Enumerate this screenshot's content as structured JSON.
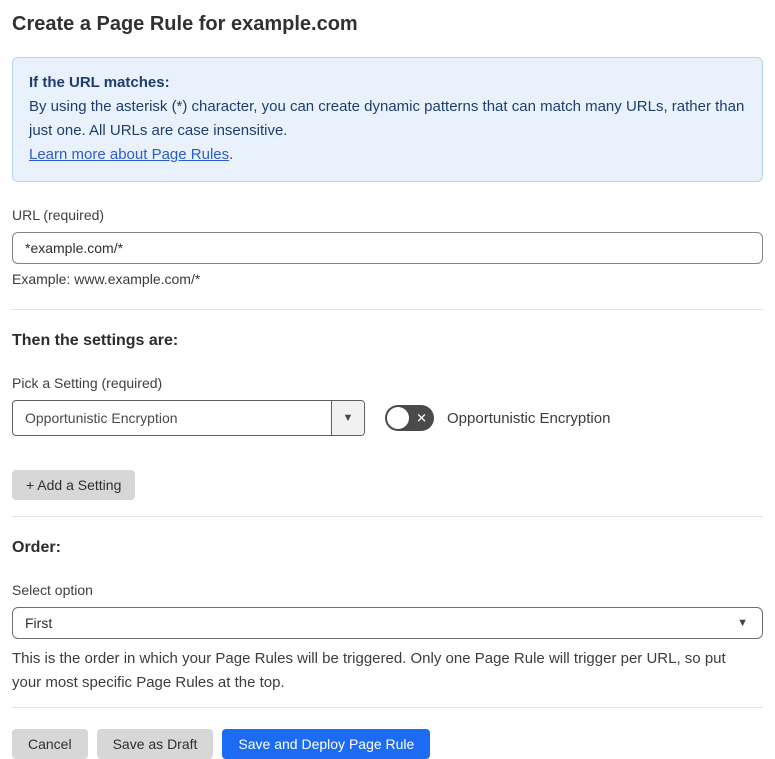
{
  "page": {
    "title": "Create a Page Rule for example.com"
  },
  "info_box": {
    "heading": "If the URL matches:",
    "body": "By using the asterisk (*) character, you can create dynamic patterns that can match many URLs, rather than just one. All URLs are case insensitive.",
    "link_label": "Learn more about Page Rules",
    "link_suffix": "."
  },
  "url_field": {
    "label": "URL (required)",
    "value": "*example.com/*",
    "example": "Example: www.example.com/*"
  },
  "settings_section": {
    "heading": "Then the settings are:",
    "picker_label": "Pick a Setting (required)",
    "picker_value": "Opportunistic Encryption",
    "toggle_state": "off",
    "toggle_label": "Opportunistic Encryption",
    "add_button_label": "+ Add a Setting"
  },
  "order_section": {
    "heading": "Order:",
    "select_label": "Select option",
    "select_value": "First",
    "help_text": "This is the order in which your Page Rules will be triggered. Only one Page Rule will trigger per URL, so put your most specific Page Rules at the top."
  },
  "footer": {
    "cancel_label": "Cancel",
    "save_draft_label": "Save as Draft",
    "save_deploy_label": "Save and Deploy Page Rule"
  },
  "icons": {
    "dropdown_caret": "▼",
    "select_caret": "▼",
    "toggle_x": "✕"
  },
  "colors": {
    "primary_button": "#1b6cf2",
    "info_background": "#e9f2fc",
    "info_border": "#b8d3f1",
    "info_text": "#1e3d6f",
    "link": "#2a5bd0",
    "toggle_off": "#4a4a4a",
    "gray_button": "#d7d7d7"
  }
}
